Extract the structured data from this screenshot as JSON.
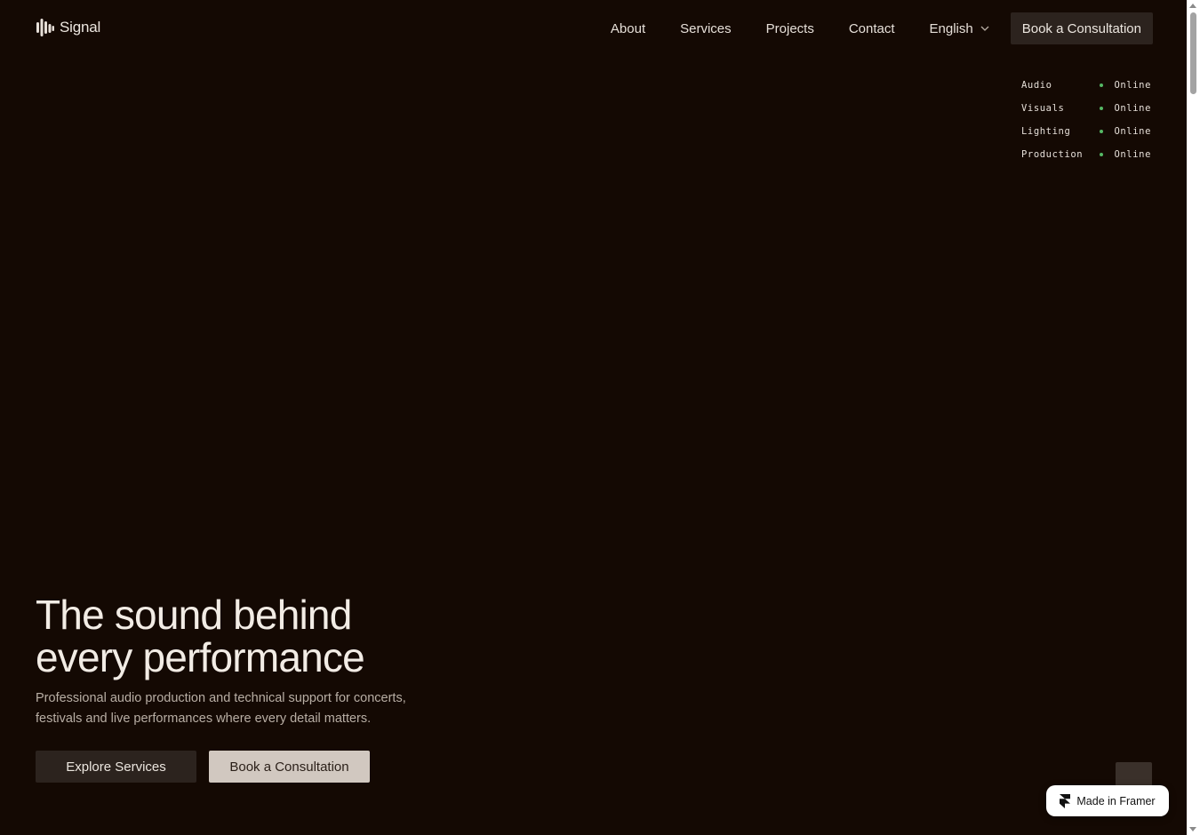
{
  "header": {
    "brand": "Signal",
    "nav": [
      {
        "label": "About"
      },
      {
        "label": "Services"
      },
      {
        "label": "Projects"
      },
      {
        "label": "Contact"
      }
    ],
    "language": "English",
    "cta_label": "Book a Consultation"
  },
  "status": [
    {
      "label": "Audio",
      "value": "Online"
    },
    {
      "label": "Visuals",
      "value": "Online"
    },
    {
      "label": "Lighting",
      "value": "Online"
    },
    {
      "label": "Production",
      "value": "Online"
    }
  ],
  "status_color": "#55b865",
  "hero": {
    "title_line1": "The sound behind",
    "title_line2": "every performance",
    "subtitle_line1": "Professional audio production and technical support for concerts,",
    "subtitle_line2": "festivals and live performances where every detail matters.",
    "primary_cta": "Explore Services",
    "secondary_cta": "Book a Consultation"
  },
  "badge": {
    "label": "Made in Framer",
    "icon": "framer-icon"
  },
  "icons": {
    "logo": "signal-logo-icon",
    "language": "chevron-down-icon"
  },
  "colors": {
    "background": "#140903",
    "button_dark": "#2c231e",
    "button_light": "#d1c8c0",
    "text": "#ece6df"
  }
}
